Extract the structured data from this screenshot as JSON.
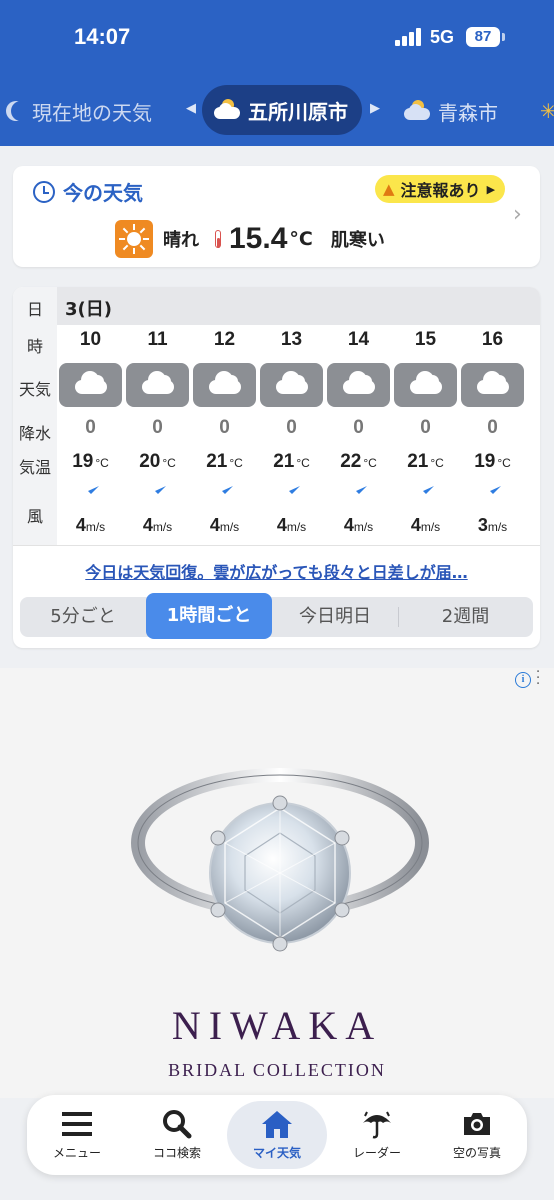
{
  "status": {
    "time": "14:07",
    "network": "5G",
    "battery": "87"
  },
  "cities": {
    "prev": "現在地の天気",
    "current": "五所川原市",
    "next": "青森市"
  },
  "now": {
    "title": "今の天気",
    "alert": "注意報あり",
    "condition": "晴れ",
    "temperature": "15.4",
    "temp_unit": "°C",
    "feel": "肌寒い",
    "icon": "sunny-icon"
  },
  "hourly": {
    "labels": {
      "day": "日",
      "hour": "時",
      "weather": "天気",
      "precip": "降水",
      "temp": "気温",
      "wind": "風"
    },
    "date": "3(日)",
    "temp_unit": "°C",
    "wind_unit": "m/s",
    "hours": [
      {
        "hour": "10",
        "weather": "cloudy-icon",
        "precip": "0",
        "temp": "19",
        "wind": "4"
      },
      {
        "hour": "11",
        "weather": "cloudy-icon",
        "precip": "0",
        "temp": "20",
        "wind": "4"
      },
      {
        "hour": "12",
        "weather": "cloudy-icon",
        "precip": "0",
        "temp": "21",
        "wind": "4"
      },
      {
        "hour": "13",
        "weather": "cloudy-icon",
        "precip": "0",
        "temp": "21",
        "wind": "4"
      },
      {
        "hour": "14",
        "weather": "cloudy-icon",
        "precip": "0",
        "temp": "22",
        "wind": "4"
      },
      {
        "hour": "15",
        "weather": "cloudy-icon",
        "precip": "0",
        "temp": "21",
        "wind": "4"
      },
      {
        "hour": "16",
        "weather": "cloudy-icon",
        "precip": "0",
        "temp": "19",
        "wind": "3"
      }
    ],
    "headline": "今日は天気回復。雲が広がっても段々と日差しが届…",
    "segments": [
      "5分ごと",
      "1時間ごと",
      "今日明日",
      "2週間"
    ],
    "active_segment": "1時間ごと"
  },
  "ad": {
    "brand": "NIWAKA",
    "subtitle": "BRIDAL COLLECTION"
  },
  "nav": [
    {
      "label": "メニュー",
      "icon": "menu-icon"
    },
    {
      "label": "ココ検索",
      "icon": "search-icon"
    },
    {
      "label": "マイ天気",
      "icon": "home-icon",
      "active": true
    },
    {
      "label": "レーダー",
      "icon": "umbrella-icon"
    },
    {
      "label": "空の写真",
      "icon": "camera-icon"
    }
  ],
  "colors": {
    "header": "#2b62c4",
    "active_tab": "#4a8bea",
    "alert_bg": "#fbe64b",
    "sun_icon": "#ef8a22",
    "wind_arrow": "#2f7de1"
  }
}
